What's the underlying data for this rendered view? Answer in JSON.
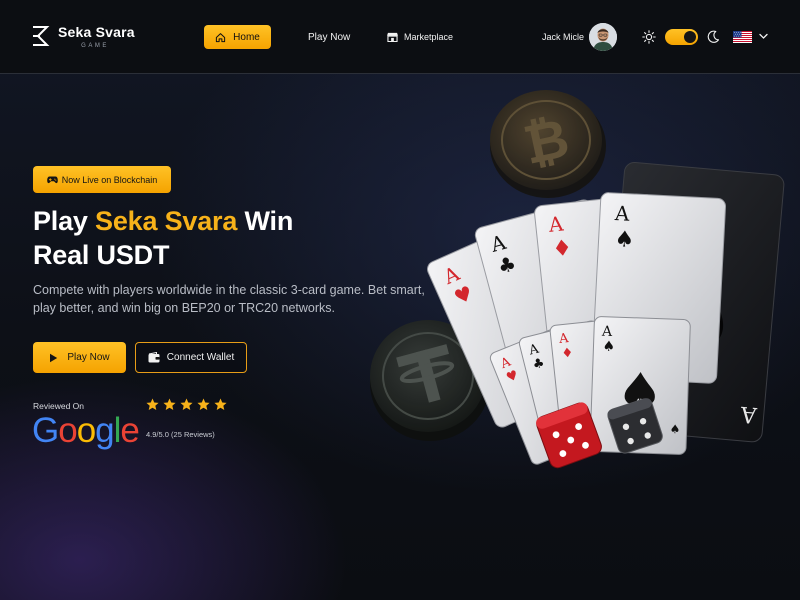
{
  "header": {
    "brand": {
      "name": "Seka Svara",
      "tagline": "GAME"
    },
    "nav": {
      "home": "Home",
      "play": "Play Now",
      "marketplace": "Marketplace"
    },
    "user": {
      "name": "Jack Micle"
    },
    "theme_toggle": {
      "state": "dark"
    },
    "language": {
      "flag": "us-flag-icon"
    }
  },
  "hero": {
    "badge": "Now Live on Blockchain",
    "headline": {
      "line1_prefix": "Play ",
      "line1_accent": "Seka Svara",
      "line1_suffix": " Win",
      "line2": "Real USDT"
    },
    "description": "Compete with players worldwide in the classic 3-card game. Bet smart, play better, and win big on BEP20 or TRC20 networks.",
    "buttons": {
      "play": "Play Now",
      "wallet": "Connect Wallet"
    },
    "review": {
      "label": "Reviewed On",
      "provider": "Google",
      "stars": 5,
      "rating_text": "4.9/5.0 (25 Reviews)"
    }
  },
  "colors": {
    "accent": "#f7b21a",
    "accent_gradient_top": "#ffc226",
    "accent_gradient_bottom": "#f5a300",
    "background": "#0d1017",
    "header_bg": "#0c0e12"
  },
  "icons": {
    "home": "home-icon",
    "marketplace": "store-icon",
    "sun": "sun-icon",
    "moon": "moon-icon",
    "badge": "gamepad-icon",
    "play": "play-icon",
    "wallet": "wallet-icon",
    "star": "star-icon"
  }
}
